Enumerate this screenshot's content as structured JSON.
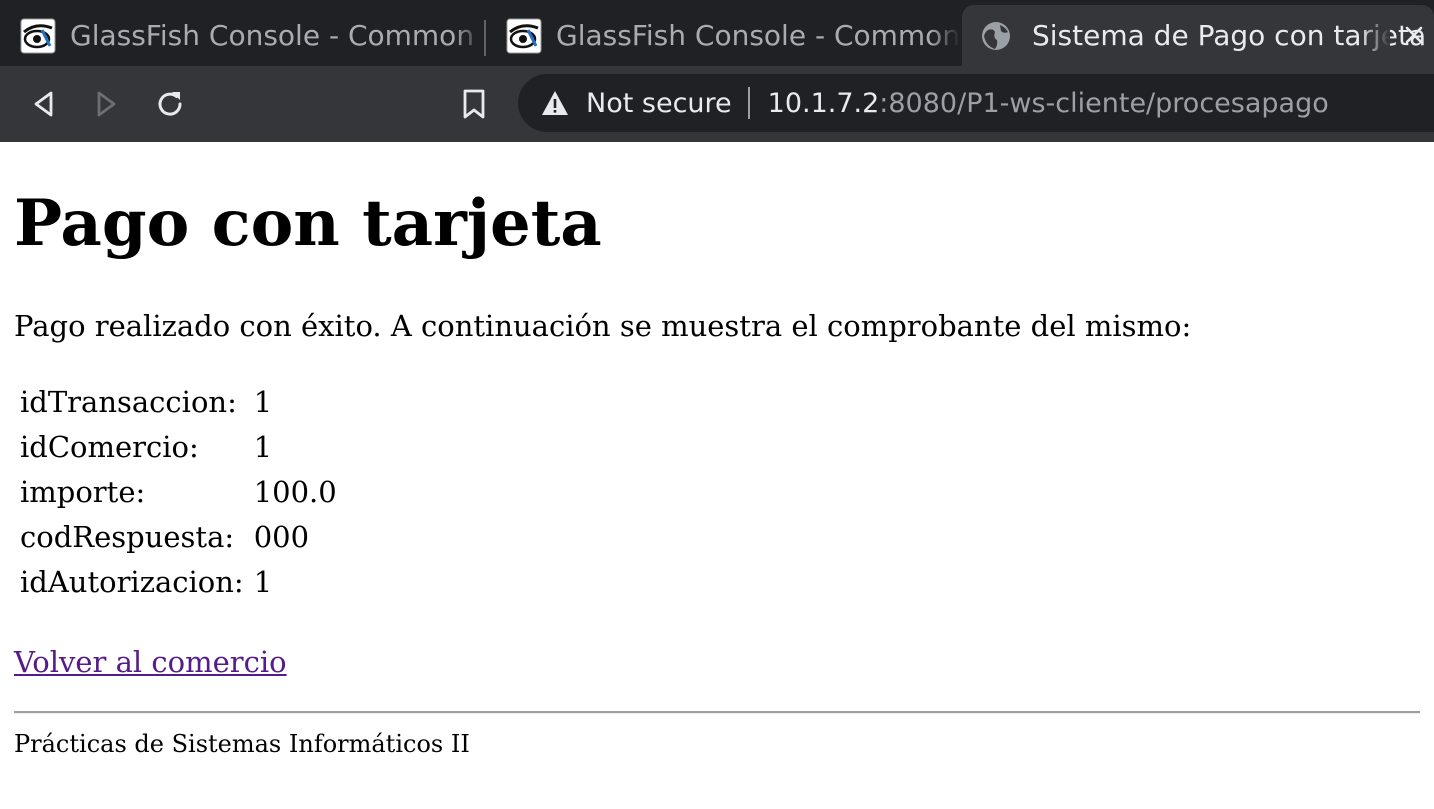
{
  "browser": {
    "tabs": [
      {
        "title": "GlassFish Console - Common Tasks",
        "favicon": "glassfish-icon",
        "active": false
      },
      {
        "title": "GlassFish Console - Common Tasks",
        "favicon": "glassfish-icon",
        "active": false
      },
      {
        "title": "Sistema de Pago con tarjeta",
        "favicon": "globe-icon",
        "active": true
      }
    ],
    "security_label": "Not secure",
    "url_host": "10.1.7.2",
    "url_rest": ":8080/P1-ws-cliente/procesapago"
  },
  "page": {
    "heading": "Pago con tarjeta",
    "intro": "Pago realizado con éxito. A continuación se muestra el comprobante del mismo:",
    "receipt": [
      {
        "key": "idTransaccion:",
        "value": "1"
      },
      {
        "key": "idComercio:",
        "value": "1"
      },
      {
        "key": "importe:",
        "value": "100.0"
      },
      {
        "key": "codRespuesta:",
        "value": "000"
      },
      {
        "key": "idAutorizacion:",
        "value": "1"
      }
    ],
    "back_link": "Volver al comercio",
    "footer": "Prácticas de Sistemas Informáticos II"
  },
  "colors": {
    "tabbar_bg": "#202124",
    "toolbar_bg": "#35363a",
    "visited_link": "#551a8b"
  }
}
